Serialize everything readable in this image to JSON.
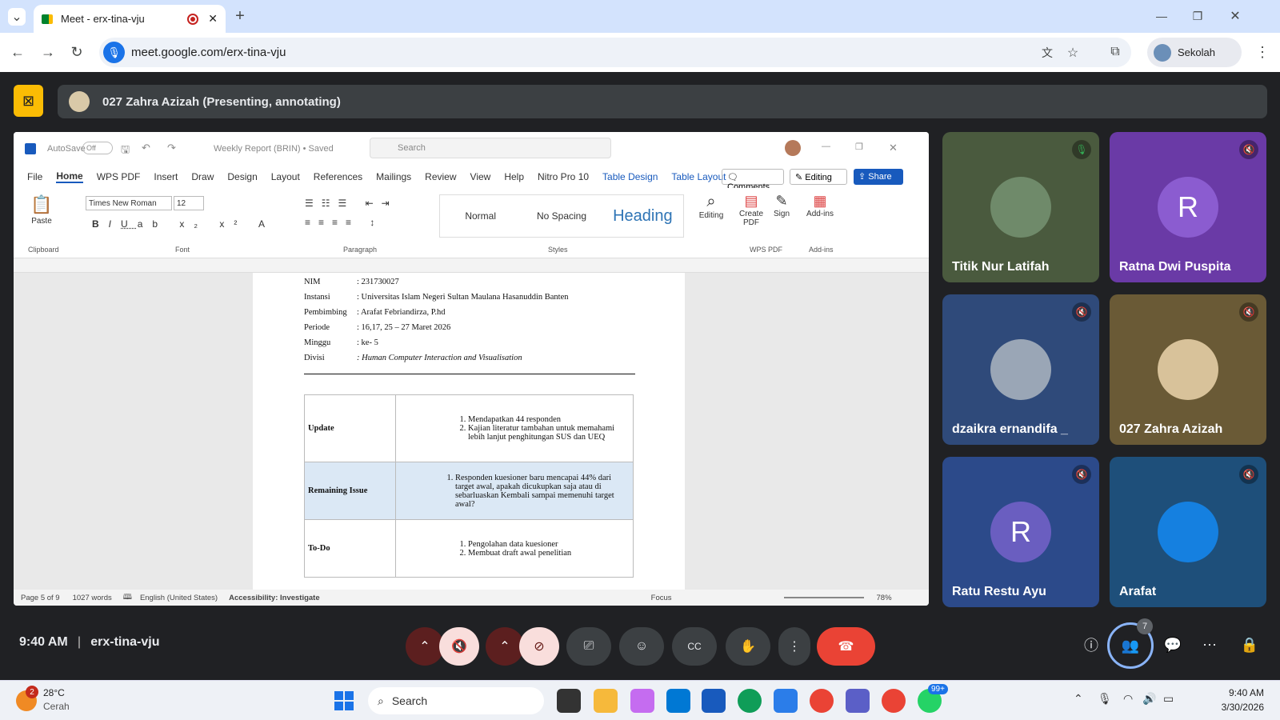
{
  "browser": {
    "tab_title": "Meet - erx-tina-vju",
    "url": "meet.google.com/erx-tina-vju",
    "profile": "Sekolah"
  },
  "meet": {
    "presenter_banner": "027 Zahra Azizah (Presenting, annotating)",
    "time": "9:40 AM",
    "meeting_code": "erx-tina-vju",
    "participant_count": "7",
    "tiles": [
      {
        "name": "Titik Nur Latifah"
      },
      {
        "name": "Ratna Dwi Puspita",
        "initial": "R"
      },
      {
        "name": "dzaikra ernandifa _"
      },
      {
        "name": "027 Zahra Azizah"
      },
      {
        "name": "Ratu Restu Ayu",
        "initial": "R"
      },
      {
        "name": "Arafat"
      }
    ]
  },
  "word": {
    "autosave": "AutoSave",
    "autosave_state": "Off",
    "doc_title": "Weekly Report (BRIN) • Saved",
    "search_placeholder": "Search",
    "tabs": [
      "File",
      "Home",
      "WPS PDF",
      "Insert",
      "Draw",
      "Design",
      "Layout",
      "References",
      "Mailings",
      "Review",
      "View",
      "Help",
      "Nitro Pro 10",
      "Table Design",
      "Table Layout"
    ],
    "comments": "Comments",
    "editing": "Editing",
    "share": "Share",
    "font": "Times New Roman",
    "size": "12",
    "styles": [
      "Normal",
      "No Spacing",
      "Heading"
    ],
    "groups": {
      "clipboard": "Clipboard",
      "font": "Font",
      "paragraph": "Paragraph",
      "styles": "Styles",
      "wpspdf": "WPS PDF",
      "addins": "Add-ins"
    },
    "buttons": {
      "paste": "Paste",
      "editing": "Editing",
      "create_pdf": "Create PDF",
      "sign": "Sign",
      "addins": "Add-ins"
    },
    "doc": {
      "fields": [
        {
          "label": "NIM",
          "value": ": 231730027"
        },
        {
          "label": "Instansi",
          "value": ": Universitas Islam Negeri Sultan Maulana Hasanuddin Banten"
        },
        {
          "label": "Pembimbing",
          "value": ": Arafat Febriandirza, P.hd"
        },
        {
          "label": "Periode",
          "value": ": 16,17, 25 – 27 Maret 2026"
        },
        {
          "label": "Minggu",
          "value": ": ke- 5"
        },
        {
          "label": "Divisi",
          "value": ": Human Computer Interaction and Visualisation"
        }
      ],
      "rows": [
        {
          "head": "Update",
          "items": [
            "Mendapatkan 44 responden",
            "Kajian literatur tambahan untuk memahami lebih lanjut penghitungan SUS dan UEQ"
          ]
        },
        {
          "head": "Remaining Issue",
          "items": [
            "Responden kuesioner baru mencapai 44% dari target awal, apakah dicukupkan saja atau di sebarluaskan Kembali sampai memenuhi target awal?"
          ]
        },
        {
          "head": "To-Do",
          "items": [
            "Pengolahan data kuesioner",
            "Membuat draft awal penelitian"
          ]
        }
      ]
    },
    "status": {
      "page": "Page 5 of 9",
      "words": "1027 words",
      "language": "English (United States)",
      "accessibility": "Accessibility: Investigate",
      "focus": "Focus",
      "zoom": "78%"
    }
  },
  "taskbar": {
    "temp": "28°C",
    "weather": "Cerah",
    "weather_badge": "2",
    "search": "Search",
    "whatsapp_badge": "99+",
    "time": "9:40 AM",
    "date": "3/30/2026"
  }
}
